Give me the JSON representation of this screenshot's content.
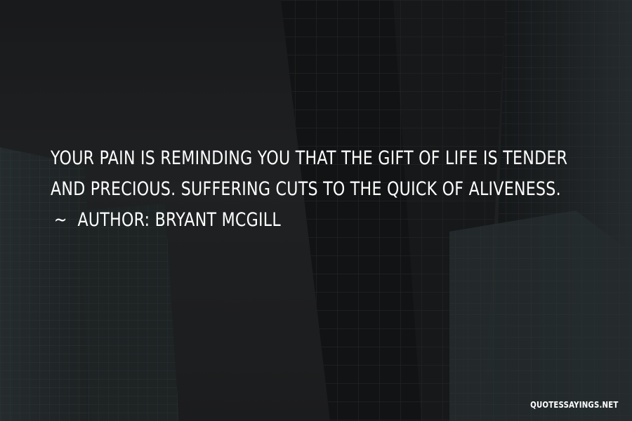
{
  "quote": {
    "line1": "Your pain is reminding you that the gift of life is tender",
    "line2": "and precious. Suffering cuts to the quick of aliveness.",
    "tilde": "~",
    "author_prefix": "Author:",
    "author_name": "Bryant McGill"
  },
  "watermark": "QUOTESSAYINGS.NET",
  "colors": {
    "background": "#2b2d2f",
    "text": "#ffffff"
  }
}
